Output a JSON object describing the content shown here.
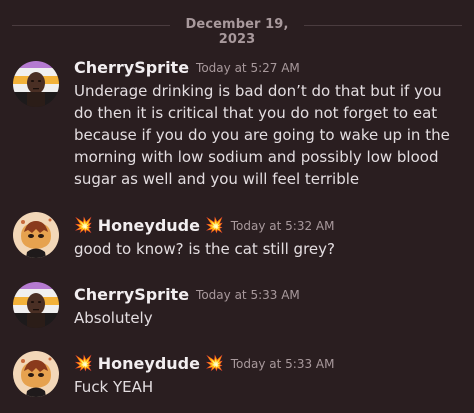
{
  "date_divider": "December 19, 2023",
  "messages": [
    {
      "username": "CherrySprite",
      "timestamp": "Today at 5:27 AM",
      "text": "Underage drinking is bad don’t do that but if you do then it is critical that you do not forget to eat because if you do you are going to wake up in the morning with low sodium and possibly low blood sugar as well and you will feel terrible"
    },
    {
      "username": "Honeydude",
      "prefix_emoji": "💥",
      "suffix_emoji": "💥",
      "timestamp": "Today at 5:32 AM",
      "text": "good to know? is the cat still grey?"
    },
    {
      "username": "CherrySprite",
      "timestamp": "Today at 5:33 AM",
      "text": "Absolutely"
    },
    {
      "username": "Honeydude",
      "prefix_emoji": "💥",
      "suffix_emoji": "💥",
      "timestamp": "Today at 5:33 AM",
      "text": "Fuck YEAH"
    }
  ],
  "icons": {
    "collision": "collision-emoji-icon"
  },
  "colors": {
    "background": "#2a1e20",
    "username": "#f2eef0",
    "timestamp": "#a8999c",
    "message_text": "#e3dde0",
    "emoji": "#ff4a2a"
  }
}
